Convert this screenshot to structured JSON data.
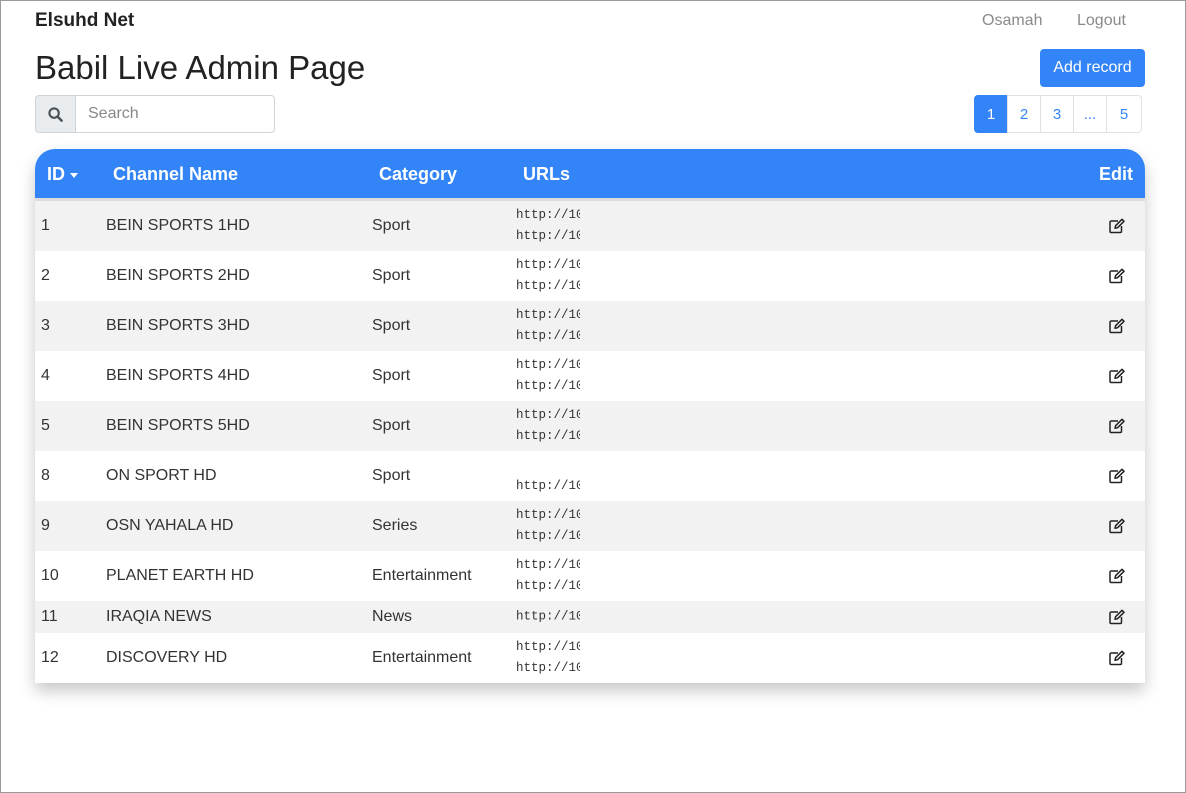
{
  "navbar": {
    "brand": "Elsuhd Net",
    "user": "Osamah",
    "logout": "Logout"
  },
  "page": {
    "title": "Babil Live Admin Page",
    "add_button": "Add record"
  },
  "search": {
    "placeholder": "Search",
    "icon": "search-icon"
  },
  "pagination": [
    "1",
    "2",
    "3",
    "...",
    "5"
  ],
  "table": {
    "headers": {
      "id": "ID",
      "name": "Channel Name",
      "category": "Category",
      "urls": "URLs",
      "edit": "Edit"
    },
    "edit_icon": "edit-icon",
    "rows": [
      {
        "id": "1",
        "name": "BEIN SPORTS 1HD",
        "category": "Sport",
        "urls": [
          "http://10",
          "http://10"
        ]
      },
      {
        "id": "2",
        "name": "BEIN SPORTS 2HD",
        "category": "Sport",
        "urls": [
          "http://10",
          "http://10"
        ]
      },
      {
        "id": "3",
        "name": "BEIN SPORTS 3HD",
        "category": "Sport",
        "urls": [
          "http://10",
          "http://10"
        ]
      },
      {
        "id": "4",
        "name": "BEIN SPORTS 4HD",
        "category": "Sport",
        "urls": [
          "http://10",
          "http://10"
        ]
      },
      {
        "id": "5",
        "name": "BEIN SPORTS 5HD",
        "category": "Sport",
        "urls": [
          "http://10",
          "http://10"
        ]
      },
      {
        "id": "8",
        "name": "ON SPORT HD",
        "category": "Sport",
        "urls": [
          "",
          "http://10"
        ]
      },
      {
        "id": "9",
        "name": "OSN YAHALA HD",
        "category": "Series",
        "urls": [
          "http://10",
          "http://10"
        ]
      },
      {
        "id": "10",
        "name": "PLANET EARTH HD",
        "category": "Entertainment",
        "urls": [
          "http://10",
          "http://10"
        ]
      },
      {
        "id": "11",
        "name": "IRAQIA NEWS",
        "category": "News",
        "urls": [
          "http://10"
        ]
      },
      {
        "id": "12",
        "name": "DISCOVERY HD",
        "category": "Entertainment",
        "urls": [
          "http://10",
          "http://10"
        ]
      }
    ]
  }
}
